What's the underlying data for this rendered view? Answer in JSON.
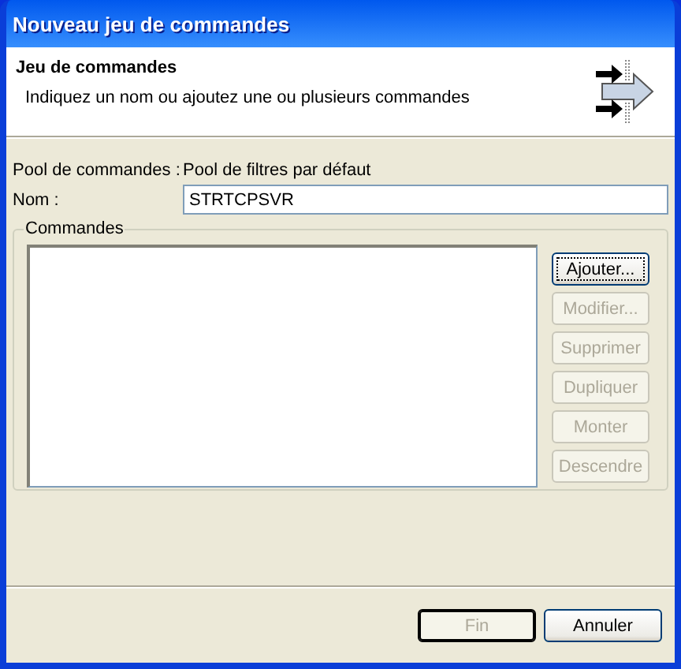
{
  "window": {
    "title": "Nouveau jeu de commandes"
  },
  "header": {
    "title": "Jeu de commandes",
    "description": "Indiquez un nom ou ajoutez une ou plusieurs commandes"
  },
  "pool": {
    "label": "Pool de commandes :",
    "value": "Pool de filtres par défaut"
  },
  "name_field": {
    "label": "Nom :",
    "value": "STRTCPSVR"
  },
  "commands": {
    "title": "Commandes",
    "buttons": [
      {
        "label": "Ajouter...",
        "disabled": false,
        "focused": true
      },
      {
        "label": "Modifier...",
        "disabled": true,
        "focused": false
      },
      {
        "label": "Supprimer",
        "disabled": true,
        "focused": false
      },
      {
        "label": "Dupliquer",
        "disabled": true,
        "focused": false
      },
      {
        "label": "Monter",
        "disabled": true,
        "focused": false
      },
      {
        "label": "Descendre",
        "disabled": true,
        "focused": false
      }
    ]
  },
  "footer_buttons": [
    {
      "label": "Fin",
      "disabled": true,
      "default": true
    },
    {
      "label": "Annuler",
      "disabled": false,
      "default": false
    }
  ]
}
